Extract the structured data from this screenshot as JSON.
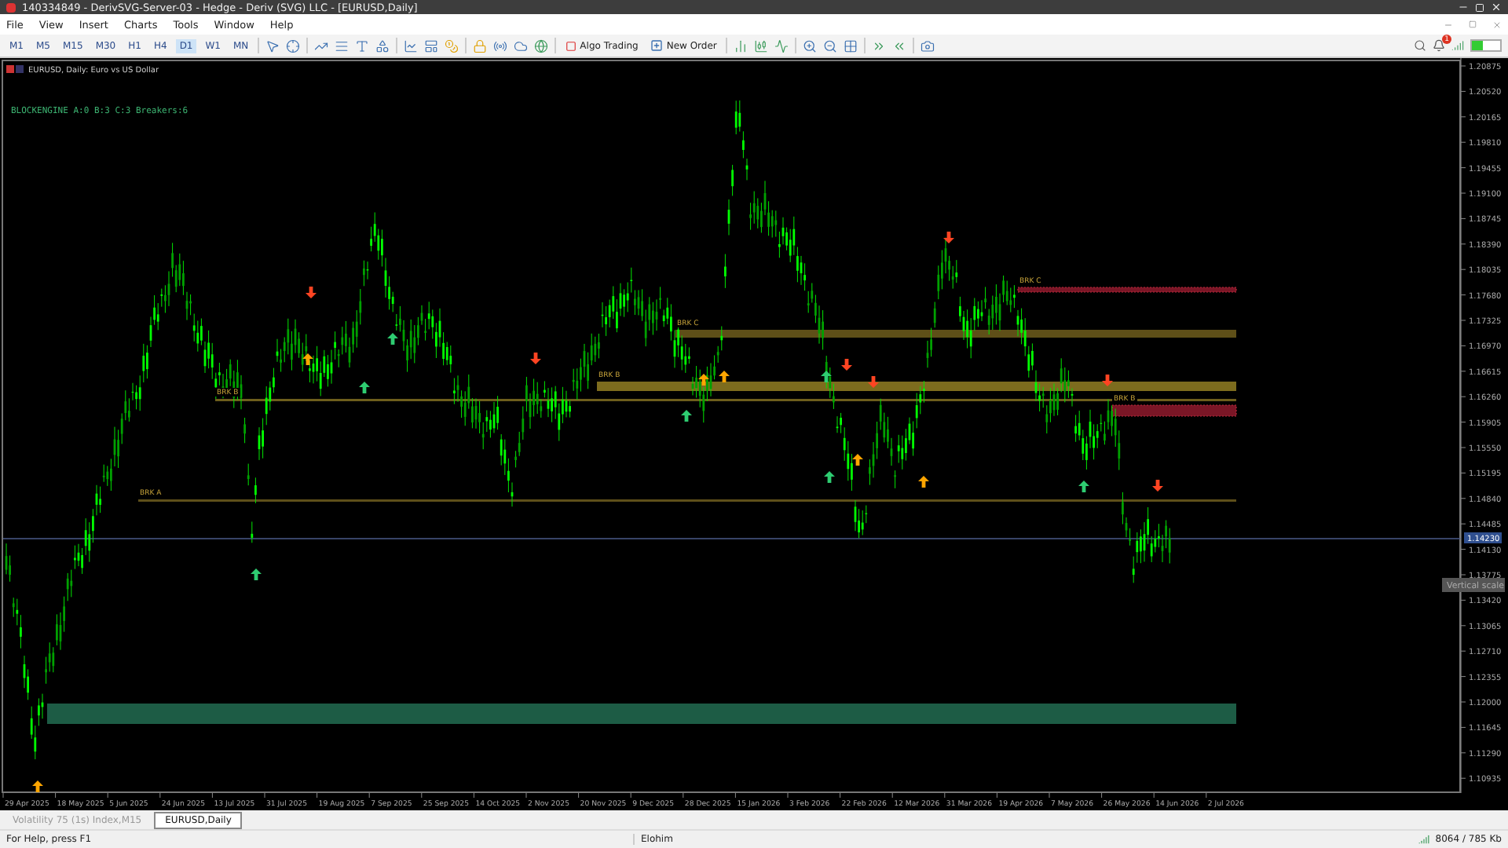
{
  "window": {
    "title": "140334849 - DerivSVG-Server-03 - Hedge - Deriv (SVG) LLC - [EURUSD,Daily]"
  },
  "menu": [
    "File",
    "View",
    "Insert",
    "Charts",
    "Tools",
    "Window",
    "Help"
  ],
  "timeframes": [
    {
      "label": "M1",
      "selected": false
    },
    {
      "label": "M5",
      "selected": false
    },
    {
      "label": "M15",
      "selected": false
    },
    {
      "label": "M30",
      "selected": false
    },
    {
      "label": "H1",
      "selected": false
    },
    {
      "label": "H4",
      "selected": false
    },
    {
      "label": "D1",
      "selected": true
    },
    {
      "label": "W1",
      "selected": false
    },
    {
      "label": "MN",
      "selected": false
    }
  ],
  "toolbar_buttons": [
    "Algo Trading",
    "New Order"
  ],
  "notifications": {
    "count": "1"
  },
  "chart": {
    "symbol": "EURUSD, Daily: Euro vs US Dollar",
    "indicator": "BLOCKENGINE  A:0 B:3 C:3 Breakers:6",
    "zones": [
      {
        "color": "#1d5c45"
      },
      {
        "label": "BRK A",
        "color": "#5e4f1a"
      },
      {
        "label": "BRK B",
        "color": "#6e5e1c"
      },
      {
        "label": "BRK B",
        "color": "#7d6c1e"
      },
      {
        "label": "BRK C",
        "color": "#5e4f18"
      },
      {
        "label": "BRK C",
        "color": "#7a1626"
      },
      {
        "label": "BRK B",
        "color": "#7a1626"
      }
    ],
    "current_price": "1.14230",
    "tooltip": "Vertical scale",
    "price_ticks": [
      "1.20875",
      "1.20520",
      "1.20165",
      "1.19810",
      "1.19455",
      "1.19100",
      "1.18745",
      "1.18390",
      "1.18035",
      "1.17680",
      "1.17325",
      "1.16970",
      "1.16615",
      "1.16260",
      "1.15905",
      "1.15550",
      "1.15195",
      "1.14840",
      "1.14485",
      "1.14130",
      "1.13775",
      "1.13420",
      "1.13065",
      "1.12710",
      "1.12355",
      "1.12000",
      "1.11645",
      "1.11290",
      "1.10935"
    ],
    "date_ticks": [
      "29 Apr 2025",
      "18 May 2025",
      "5 Jun 2025",
      "24 Jun 2025",
      "13 Jul 2025",
      "31 Jul 2025",
      "19 Aug 2025",
      "7 Sep 2025",
      "25 Sep 2025",
      "14 Oct 2025",
      "2 Nov 2025",
      "20 Nov 2025",
      "9 Dec 2025",
      "28 Dec 2025",
      "15 Jan 2026",
      "3 Feb 2026",
      "22 Feb 2026",
      "12 Mar 2026",
      "31 Mar 2026",
      "19 Apr 2026",
      "7 May 2026",
      "26 May 2026",
      "14 Jun 2026",
      "2 Jul 2026"
    ]
  },
  "chart_tabs": [
    {
      "label": "Volatility 75 (1s) Index,M15",
      "selected": false
    },
    {
      "label": "EURUSD,Daily",
      "selected": true
    }
  ],
  "status_bar": {
    "help": "For Help, press F1",
    "profile": "Elohim",
    "traffic": "8064 / 785 Kb"
  }
}
